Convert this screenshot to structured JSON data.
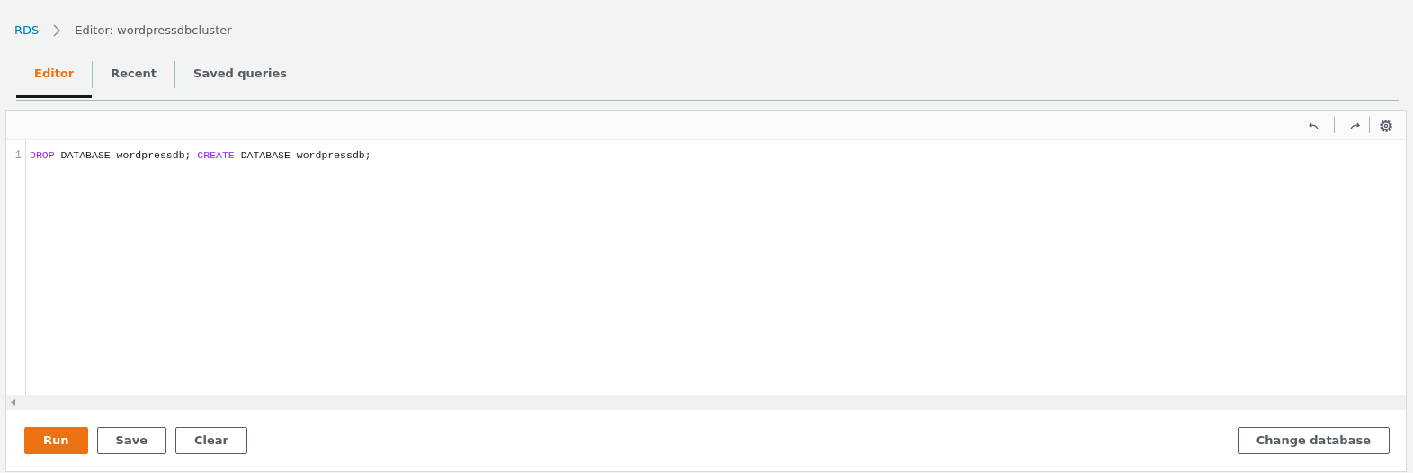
{
  "breadcrumb": [
    {
      "label": "RDS",
      "kind": "link"
    },
    {
      "label": "Editor: wordpressdbcluster",
      "kind": "current"
    }
  ],
  "tabs": [
    {
      "label": "Editor",
      "selected": true
    },
    {
      "label": "Recent",
      "selected": false
    },
    {
      "label": "Saved queries",
      "selected": false
    }
  ],
  "editor": {
    "lines": [
      {
        "number": "1",
        "tokens": [
          {
            "text": "DROP",
            "kind": "keyword"
          },
          {
            "text": " DATABASE wordpressdb; ",
            "kind": "plain"
          },
          {
            "text": "CREATE",
            "kind": "keyword"
          },
          {
            "text": " DATABASE wordpressdb;",
            "kind": "plain"
          }
        ]
      }
    ]
  },
  "actions": [
    {
      "label": "Run",
      "kind": "primary"
    },
    {
      "label": "Save",
      "kind": "normal"
    },
    {
      "label": "Clear",
      "kind": "normal"
    }
  ],
  "secondary_actions": [
    {
      "label": "Change database"
    }
  ]
}
